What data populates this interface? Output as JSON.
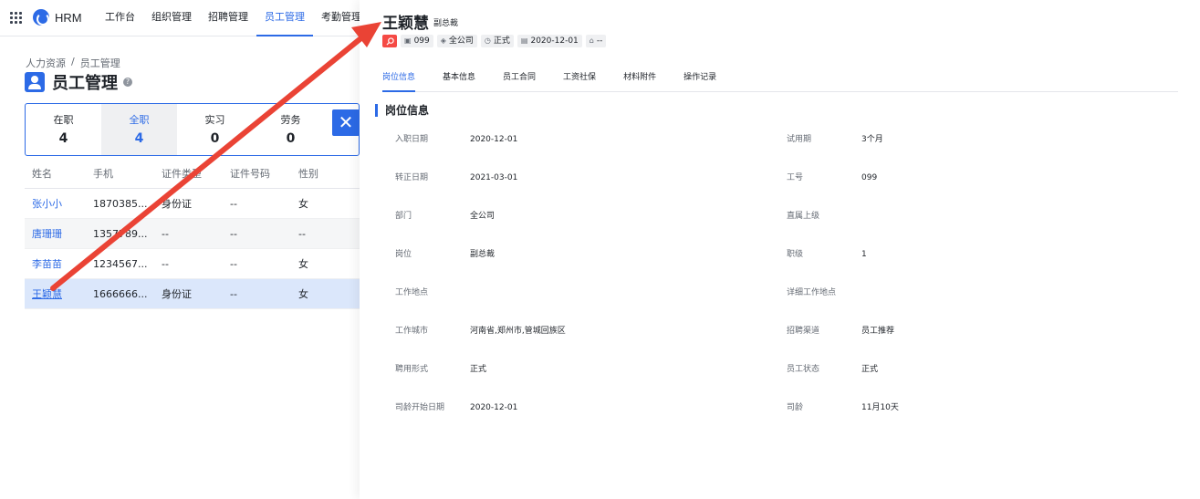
{
  "app": {
    "logo_text": "HRM"
  },
  "topnav": {
    "items": [
      {
        "label": "工作台"
      },
      {
        "label": "组织管理"
      },
      {
        "label": "招聘管理"
      },
      {
        "label": "员工管理"
      },
      {
        "label": "考勤管理"
      }
    ],
    "active_index": 3
  },
  "breadcrumb": {
    "root": "人力资源",
    "separator": "/",
    "current": "员工管理"
  },
  "page": {
    "title": "员工管理",
    "help": "?"
  },
  "stats": [
    {
      "label": "在职",
      "count": "4"
    },
    {
      "label": "全职",
      "count": "4"
    },
    {
      "label": "实习",
      "count": "0"
    },
    {
      "label": "劳务",
      "count": "0"
    }
  ],
  "stats_active_index": 1,
  "close_button": {
    "label": "✕"
  },
  "table": {
    "columns": [
      "姓名",
      "手机",
      "证件类型",
      "证件号码",
      "性别"
    ],
    "rows": [
      {
        "name": "张小小",
        "phone": "1870385...",
        "id_type": "身份证",
        "id_no": "--",
        "gender": "女"
      },
      {
        "name": "唐珊珊",
        "phone": "1357789...",
        "id_type": "--",
        "id_no": "--",
        "gender": "--"
      },
      {
        "name": "李苗苗",
        "phone": "1234567...",
        "id_type": "--",
        "id_no": "--",
        "gender": "女"
      },
      {
        "name": "王颖慧",
        "phone": "1666666...",
        "id_type": "身份证",
        "id_no": "--",
        "gender": "女"
      }
    ],
    "selected_index": 3
  },
  "drawer": {
    "name": "王颖慧",
    "role": "副总裁",
    "tags": [
      {
        "icon": "id-card-icon",
        "text": "099"
      },
      {
        "icon": "layers-icon",
        "text": "全公司"
      },
      {
        "icon": "clock-icon",
        "text": "正式"
      },
      {
        "icon": "calendar-icon",
        "text": "2020-12-01"
      },
      {
        "icon": "user-icon",
        "text": "--"
      }
    ],
    "tabs": [
      {
        "label": "岗位信息"
      },
      {
        "label": "基本信息"
      },
      {
        "label": "员工合同"
      },
      {
        "label": "工资社保"
      },
      {
        "label": "材料附件"
      },
      {
        "label": "操作记录"
      }
    ],
    "active_tab": 0,
    "section_title": "岗位信息",
    "fields": [
      {
        "l1": "入职日期",
        "v1": "2020-12-01",
        "l2": "试用期",
        "v2": "3个月"
      },
      {
        "l1": "转正日期",
        "v1": "2021-03-01",
        "l2": "工号",
        "v2": "099"
      },
      {
        "l1": "部门",
        "v1": "全公司",
        "l2": "直属上级",
        "v2": ""
      },
      {
        "l1": "岗位",
        "v1": "副总裁",
        "l2": "职级",
        "v2": "1"
      },
      {
        "l1": "工作地点",
        "v1": "",
        "l2": "详细工作地点",
        "v2": ""
      },
      {
        "l1": "工作城市",
        "v1": "河南省,郑州市,管城回族区",
        "l2": "招聘渠道",
        "v2": "员工推荐"
      },
      {
        "l1": "聘用形式",
        "v1": "正式",
        "l2": "员工状态",
        "v2": "正式"
      },
      {
        "l1": "司龄开始日期",
        "v1": "2020-12-01",
        "l2": "司龄",
        "v2": "11月10天"
      }
    ]
  },
  "colors": {
    "accent": "#2c6ae6",
    "danger": "#f54a45",
    "annotation_arrow": "#ea4335"
  }
}
